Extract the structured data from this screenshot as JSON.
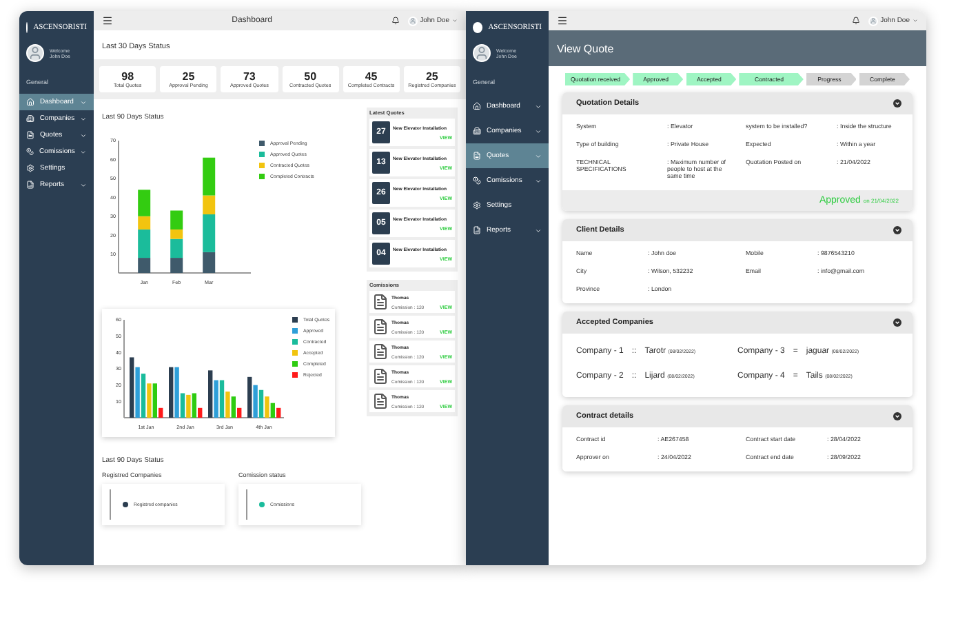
{
  "dashboard_window": {
    "sidebar": {
      "brand": "ASCENSORISTI",
      "welcome": "Welcome",
      "user": "John Doe",
      "section": "General",
      "items": [
        {
          "label": "Dashboard",
          "selected": true,
          "expandable": true
        },
        {
          "label": "Companies",
          "selected": false,
          "expandable": true
        },
        {
          "label": "Quotes",
          "selected": false,
          "expandable": true
        },
        {
          "label": "Comissions",
          "selected": false,
          "expandable": true
        },
        {
          "label": "Settings",
          "selected": false,
          "expandable": false
        },
        {
          "label": "Reports",
          "selected": false,
          "expandable": true
        }
      ]
    },
    "topbar": {
      "title": "Dashboard",
      "user": "John Doe"
    },
    "stats_heading": "Last 30 Days Status",
    "stats": [
      {
        "value": "98",
        "label": "Total Quotes"
      },
      {
        "value": "25",
        "label": "Approval Pending"
      },
      {
        "value": "73",
        "label": "Approved Quotes"
      },
      {
        "value": "50",
        "label": "Contracted Quotes"
      },
      {
        "value": "45",
        "label": "Completed Contracts"
      },
      {
        "value": "25",
        "label": "Registred Companies"
      }
    ],
    "status_chart": {
      "title": "Last 90 Days Status",
      "chart_data": {
        "type": "bar",
        "stacked": true,
        "categories": [
          "Jan",
          "Feb",
          "Mar"
        ],
        "ylim": [
          0,
          70
        ],
        "yticks": [
          10,
          20,
          30,
          40,
          50,
          60,
          70
        ],
        "series": [
          {
            "name": "Approval Pending",
            "color": "#3f5a6b",
            "values": [
              8,
              8,
              11
            ]
          },
          {
            "name": "Approved Quotes",
            "color": "#1bbc9b",
            "values": [
              15,
              10,
              20
            ]
          },
          {
            "name": "Contracted Quotes",
            "color": "#f2c40f",
            "values": [
              7,
              5,
              10
            ]
          },
          {
            "name": "Completed Contracts",
            "color": "#33cc11",
            "values": [
              14,
              10,
              20
            ]
          }
        ]
      }
    },
    "daily_chart": {
      "chart_data": {
        "type": "bar",
        "stacked": false,
        "categories": [
          "1st Jan",
          "2nd Jan",
          "3rd Jan",
          "4th Jan"
        ],
        "ylim": [
          0,
          60
        ],
        "yticks": [
          10,
          20,
          30,
          40,
          50,
          60
        ],
        "series": [
          {
            "name": "Total Quotes",
            "color": "#2c3e50",
            "values": [
              37,
              31,
              29,
              25
            ]
          },
          {
            "name": "Approved",
            "color": "#2e9fd8",
            "values": [
              31,
              31,
              23,
              20
            ]
          },
          {
            "name": "Contracted",
            "color": "#1abc9c",
            "values": [
              27,
              15,
              23,
              17
            ]
          },
          {
            "name": "Accepted",
            "color": "#f1c40f",
            "values": [
              21,
              14,
              16,
              13
            ]
          },
          {
            "name": "Completed",
            "color": "#2ecc11",
            "values": [
              21,
              15,
              13,
              9
            ]
          },
          {
            "name": "Rejected",
            "color": "#ff1a1a",
            "values": [
              6,
              6,
              6,
              6
            ]
          }
        ]
      }
    },
    "latest_quotes": {
      "title": "Latest Quotes",
      "items": [
        {
          "day": "27",
          "title": "New Elevator Installation",
          "action": "VIEW"
        },
        {
          "day": "13",
          "title": "New Elevator Installation",
          "action": "VIEW"
        },
        {
          "day": "26",
          "title": "New Elevator Installation",
          "action": "VIEW"
        },
        {
          "day": "05",
          "title": "New Elevator Installation",
          "action": "VIEW"
        },
        {
          "day": "04",
          "title": "New Elevator Installation",
          "action": "VIEW"
        }
      ]
    },
    "commissions": {
      "title": "Comissions",
      "items": [
        {
          "name": "Thomas",
          "detail": "Comission : 120",
          "action": "VIEW"
        },
        {
          "name": "Thomas",
          "detail": "Comission : 120",
          "action": "VIEW"
        },
        {
          "name": "Thomas",
          "detail": "Comission : 120",
          "action": "VIEW"
        },
        {
          "name": "Thomas",
          "detail": "Comission : 120",
          "action": "VIEW"
        },
        {
          "name": "Thomas",
          "detail": "Comission : 120",
          "action": "VIEW"
        }
      ]
    },
    "bottom": {
      "title": "Last 90 Days Status",
      "panels": [
        {
          "title": "Registred Companies",
          "legend": "Registred companies",
          "color": "#2c3e50"
        },
        {
          "title": "Comission status",
          "legend": "Comissions",
          "color": "#1abc9c"
        }
      ]
    }
  },
  "quote_window": {
    "sidebar": {
      "brand": "ASCENSORISTI",
      "welcome": "Welcome",
      "user": "John Doe",
      "section": "General",
      "items": [
        {
          "label": "Dashboard",
          "selected": false,
          "expandable": true
        },
        {
          "label": "Companies",
          "selected": false,
          "expandable": true
        },
        {
          "label": "Quotes",
          "selected": true,
          "expandable": true
        },
        {
          "label": "Comissions",
          "selected": false,
          "expandable": true
        },
        {
          "label": "Settings",
          "selected": false,
          "expandable": false
        },
        {
          "label": "Reports",
          "selected": false,
          "expandable": true
        }
      ]
    },
    "topbar": {
      "user": "John Doe"
    },
    "title": "View Quote",
    "steps": [
      {
        "label": "Quotation received",
        "done": true
      },
      {
        "label": "Approved",
        "done": true
      },
      {
        "label": "Accepted",
        "done": true
      },
      {
        "label": "Contracted",
        "done": true
      },
      {
        "label": "Progress",
        "done": false
      },
      {
        "label": "Complete",
        "done": false
      }
    ],
    "quotation_details": {
      "title": "Quotation Details",
      "separator": ":",
      "left": [
        {
          "label": "System",
          "value": "Elevator"
        },
        {
          "label": "Type of building",
          "value": "Private House"
        },
        {
          "label": "TECHNICAL SPECIFICATIONS",
          "value": "Maximum number of people to host at the same time"
        }
      ],
      "right": [
        {
          "label": "system to be installed?",
          "value": "Inside the structure"
        },
        {
          "label": "Expected",
          "value": "Within a year"
        },
        {
          "label": "Quotation Posted on",
          "value": "21/04/2022"
        }
      ],
      "status": "Approved",
      "status_date": "on 21/04/2022"
    },
    "client_details": {
      "title": "Client Details",
      "separator": ":",
      "left": [
        {
          "label": "Name",
          "value": "John doe"
        },
        {
          "label": "City",
          "value": "Wilson, 532232"
        },
        {
          "label": "Province",
          "value": "London"
        }
      ],
      "right": [
        {
          "label": "Mobile",
          "value": "9876543210"
        },
        {
          "label": "Email",
          "value": "info@gmail.com"
        }
      ]
    },
    "accepted_companies": {
      "title": "Accepted Companies",
      "items": [
        {
          "label": "Company - 1",
          "separator": "::",
          "name": "Tarotr",
          "date": "(08/02/2022)"
        },
        {
          "label": "Company - 3",
          "separator": "=",
          "name": "jaguar",
          "date": "(08/02/2022)"
        },
        {
          "label": "Company - 2",
          "separator": "::",
          "name": "Lijard",
          "date": "(08/02/2022)"
        },
        {
          "label": "Company - 4",
          "separator": "=",
          "name": "Tails",
          "date": "(08/02/2022)"
        }
      ]
    },
    "contract_details": {
      "title": "Contract details",
      "separator": ":",
      "left": [
        {
          "label": "Contract id",
          "value": "AE267458"
        },
        {
          "label": "Approver on",
          "value": "24/04/2022"
        }
      ],
      "right": [
        {
          "label": "Contract start date",
          "value": "28/04/2022"
        },
        {
          "label": "Contract end date",
          "value": "28/09/2022"
        }
      ]
    }
  }
}
